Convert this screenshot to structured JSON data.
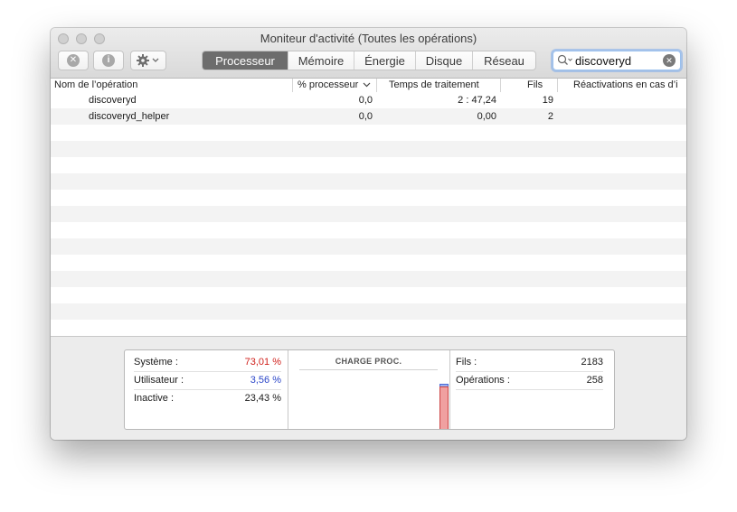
{
  "window": {
    "title": "Moniteur d'activité (Toutes les opérations)"
  },
  "toolbar": {
    "close_process_icon": "x-circle-icon",
    "info_icon": "info-icon",
    "info_glyph": "i",
    "gear_icon": "gear-icon",
    "tabs": [
      {
        "label": "Processeur",
        "active": true
      },
      {
        "label": "Mémoire",
        "active": false
      },
      {
        "label": "Énergie",
        "active": false
      },
      {
        "label": "Disque",
        "active": false
      },
      {
        "label": "Réseau",
        "active": false
      }
    ],
    "search": {
      "value": "discoveryd",
      "placeholder": ""
    }
  },
  "table": {
    "columns": [
      "Nom de l’opération",
      "% processeur",
      "Temps de traitement",
      "Fils",
      "Réactivations en cas d’i"
    ],
    "sorted_column": "% processeur",
    "rows": [
      {
        "name": "discoveryd",
        "cpu": "0,0",
        "time": "2 : 47,24",
        "threads": "19",
        "wakeups": ""
      },
      {
        "name": "discoveryd_helper",
        "cpu": "0,0",
        "time": "0,00",
        "threads": "2",
        "wakeups": ""
      }
    ]
  },
  "stats": {
    "system": {
      "label": "Système :",
      "value": "73,01 %",
      "color": "#d0211c"
    },
    "user": {
      "label": "Utilisateur :",
      "value": "3,56 %",
      "color": "#2a45c8"
    },
    "idle": {
      "label": "Inactive :",
      "value": "23,43 %",
      "color": "#1a1a1a"
    }
  },
  "chart": {
    "title": "CHARGE PROC.",
    "system_fraction": 0.7301,
    "user_fraction": 0.0356,
    "system_color": "#f0a0a0",
    "user_color": "#9bb0ee"
  },
  "counts": {
    "threads": {
      "label": "Fils :",
      "value": "2183"
    },
    "processes": {
      "label": "Opérations :",
      "value": "258"
    }
  }
}
